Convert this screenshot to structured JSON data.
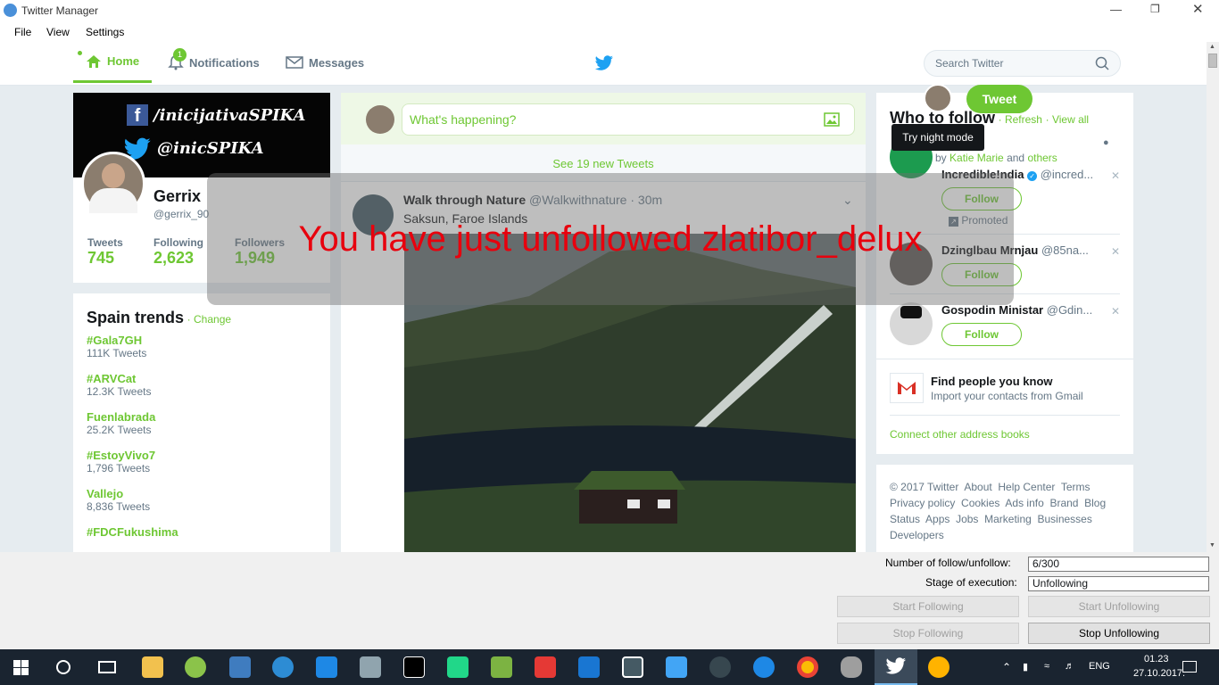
{
  "window": {
    "title": "Twitter Manager"
  },
  "menu": [
    "File",
    "View",
    "Settings"
  ],
  "nav": {
    "home": "Home",
    "notifications": "Notifications",
    "notifications_badge": "1",
    "messages": "Messages",
    "search_placeholder": "Search Twitter"
  },
  "profile": {
    "banner_line1": "/inicijativaSPIKA",
    "banner_line2": "@inicSPIKA",
    "name": "Gerrix",
    "handle": "@gerrix_90",
    "stats": [
      {
        "label": "Tweets",
        "value": "745"
      },
      {
        "label": "Following",
        "value": "2,623"
      },
      {
        "label": "Followers",
        "value": "1,949"
      }
    ]
  },
  "trends": {
    "title": "Spain trends",
    "change": "Change",
    "items": [
      {
        "name": "#Gala7GH",
        "count": "111K Tweets"
      },
      {
        "name": "#ARVCat",
        "count": "12.3K Tweets"
      },
      {
        "name": "Fuenlabrada",
        "count": "25.2K Tweets"
      },
      {
        "name": "#EstoyVivo7",
        "count": "1,796 Tweets"
      },
      {
        "name": "Vallejo",
        "count": "8,836 Tweets"
      },
      {
        "name": "#FDCFukushima",
        "count": ""
      }
    ]
  },
  "compose": {
    "placeholder": "What's happening?"
  },
  "new_tweets": "See 19 new Tweets",
  "tweet": {
    "author": "Walk through Nature",
    "handle": "@Walkwithnature",
    "time": "30m",
    "text": "Saksun, Faroe Islands"
  },
  "who_to_follow": {
    "title": "Who to follow",
    "refresh": "Refresh",
    "view_all": "View all",
    "tooltip": "Try night mode",
    "tweet_button": "Tweet",
    "followed_by_prefix": "by",
    "followed_by_name": "Katie Marie",
    "followed_by_suffix": "and",
    "followed_by_others": "others",
    "users": [
      {
        "name": "Incredible!ndia",
        "handle": "@incred...",
        "follow": "Follow",
        "promoted": "Promoted"
      },
      {
        "name": "Dzinglbau Mrnjau",
        "handle": "@85na...",
        "follow": "Follow"
      },
      {
        "name": "Gospodin Ministar",
        "handle": "@Gdin...",
        "follow": "Follow"
      }
    ],
    "find_title": "Find people you know",
    "find_sub": "Import your contacts from Gmail",
    "connect": "Connect other address books"
  },
  "footer": {
    "links": [
      "© 2017 Twitter",
      "About",
      "Help Center",
      "Terms",
      "Privacy policy",
      "Cookies",
      "Ads info",
      "Brand",
      "Blog",
      "Status",
      "Apps",
      "Jobs",
      "Marketing",
      "Businesses",
      "Developers"
    ]
  },
  "overlay": {
    "message": "You have just unfollowed zlatibor_delux"
  },
  "manager": {
    "count_label": "Number of follow/unfollow:",
    "count_value": "6/300",
    "stage_label": "Stage of execution:",
    "stage_value": "Unfollowing",
    "start_following": "Start Following",
    "start_unfollowing": "Start Unfollowing",
    "stop_following": "Stop Following",
    "stop_unfollowing": "Stop Unfollowing"
  },
  "taskbar": {
    "lang": "ENG",
    "time": "01.23",
    "date": "27.10.2017."
  },
  "colors": {
    "accent": "#6ec733",
    "overlay_text": "#e8000d",
    "taskbar": "#1a2430"
  }
}
